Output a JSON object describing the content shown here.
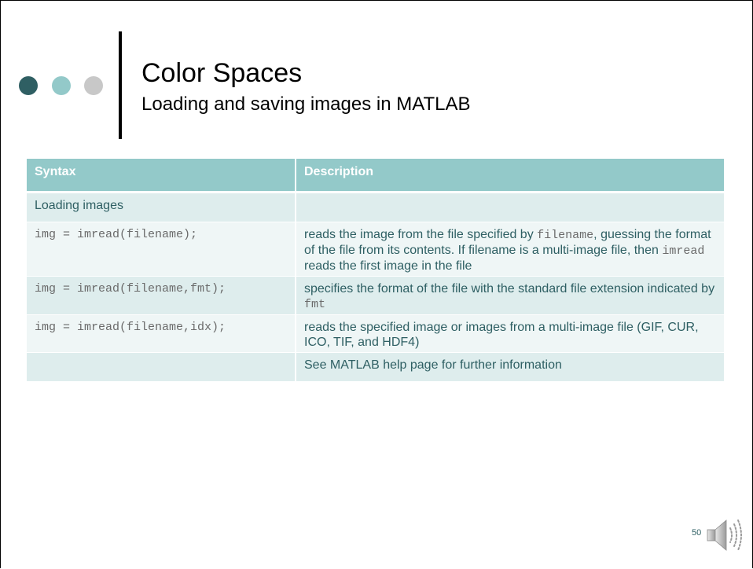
{
  "slide": {
    "title": "Color Spaces",
    "subtitle": "Loading and saving images in MATLAB",
    "page_number": "50"
  },
  "table": {
    "headers": [
      "Syntax",
      "Description"
    ],
    "rows": [
      {
        "syntax": "Loading images",
        "description": ""
      },
      {
        "syntax": "img = imread(filename);",
        "description": {
          "part1": "reads the image from the file specified by ",
          "code1": "filename",
          "part2": ", guessing the format of the file from its contents. If filename is a multi-image file, then ",
          "code2": "imread",
          "part3": " reads the first image in the file"
        }
      },
      {
        "syntax": "img = imread(filename,fmt);",
        "description": {
          "part1": "specifies the format of the file with the standard file extension indicated by ",
          "code1": "fmt"
        }
      },
      {
        "syntax": "img = imread(filename,idx);",
        "description": "reads the specified image or images from a multi-image file (GIF, CUR, ICO, TIF, and HDF4)"
      },
      {
        "syntax": "",
        "description": "See MATLAB help page for further information"
      }
    ]
  },
  "colors": {
    "header_bg": "#93c9c9",
    "row_dark": "#deeded",
    "row_light": "#eff6f6",
    "text": "#2e5f63",
    "dot_dark": "#2f5f63",
    "dot_mid": "#93c9c9",
    "dot_light": "#c8c8c8"
  },
  "icons": {
    "audio": "speaker-icon"
  }
}
